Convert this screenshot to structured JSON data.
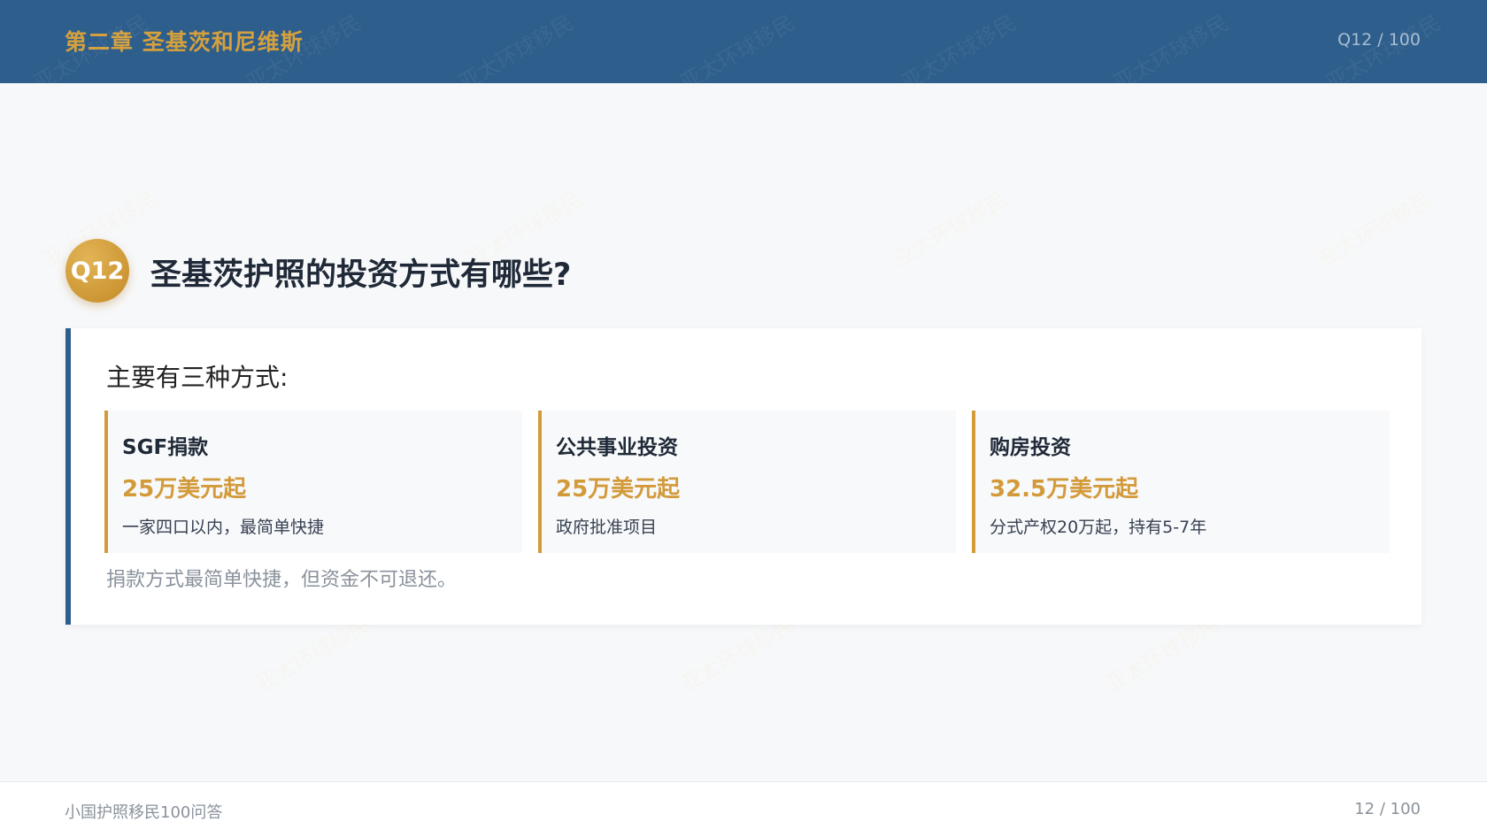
{
  "header": {
    "chapter_title": "第二章 圣基茨和尼维斯",
    "counter": "Q12 / 100"
  },
  "watermark_text": "亚太环球移民",
  "question": {
    "badge": "Q12",
    "title": "圣基茨护照的投资方式有哪些?"
  },
  "answer": {
    "intro": "主要有三种方式:",
    "options": [
      {
        "name": "SGF捐款",
        "price": "25万美元起",
        "desc": "一家四口以内，最简单快捷"
      },
      {
        "name": "公共事业投资",
        "price": "25万美元起",
        "desc": "政府批准项目"
      },
      {
        "name": "购房投资",
        "price": "32.5万美元起",
        "desc": "分式产权20万起，持有5-7年"
      }
    ],
    "note": "捐款方式最简单快捷，但资金不可退还。"
  },
  "footer": {
    "left_text": "小国护照移民100问答",
    "page_counter": "12 / 100"
  },
  "colors": {
    "header_bg": "#2e5e8c",
    "accent_gold": "#d39a3a",
    "page_bg": "#f7f8fa"
  }
}
